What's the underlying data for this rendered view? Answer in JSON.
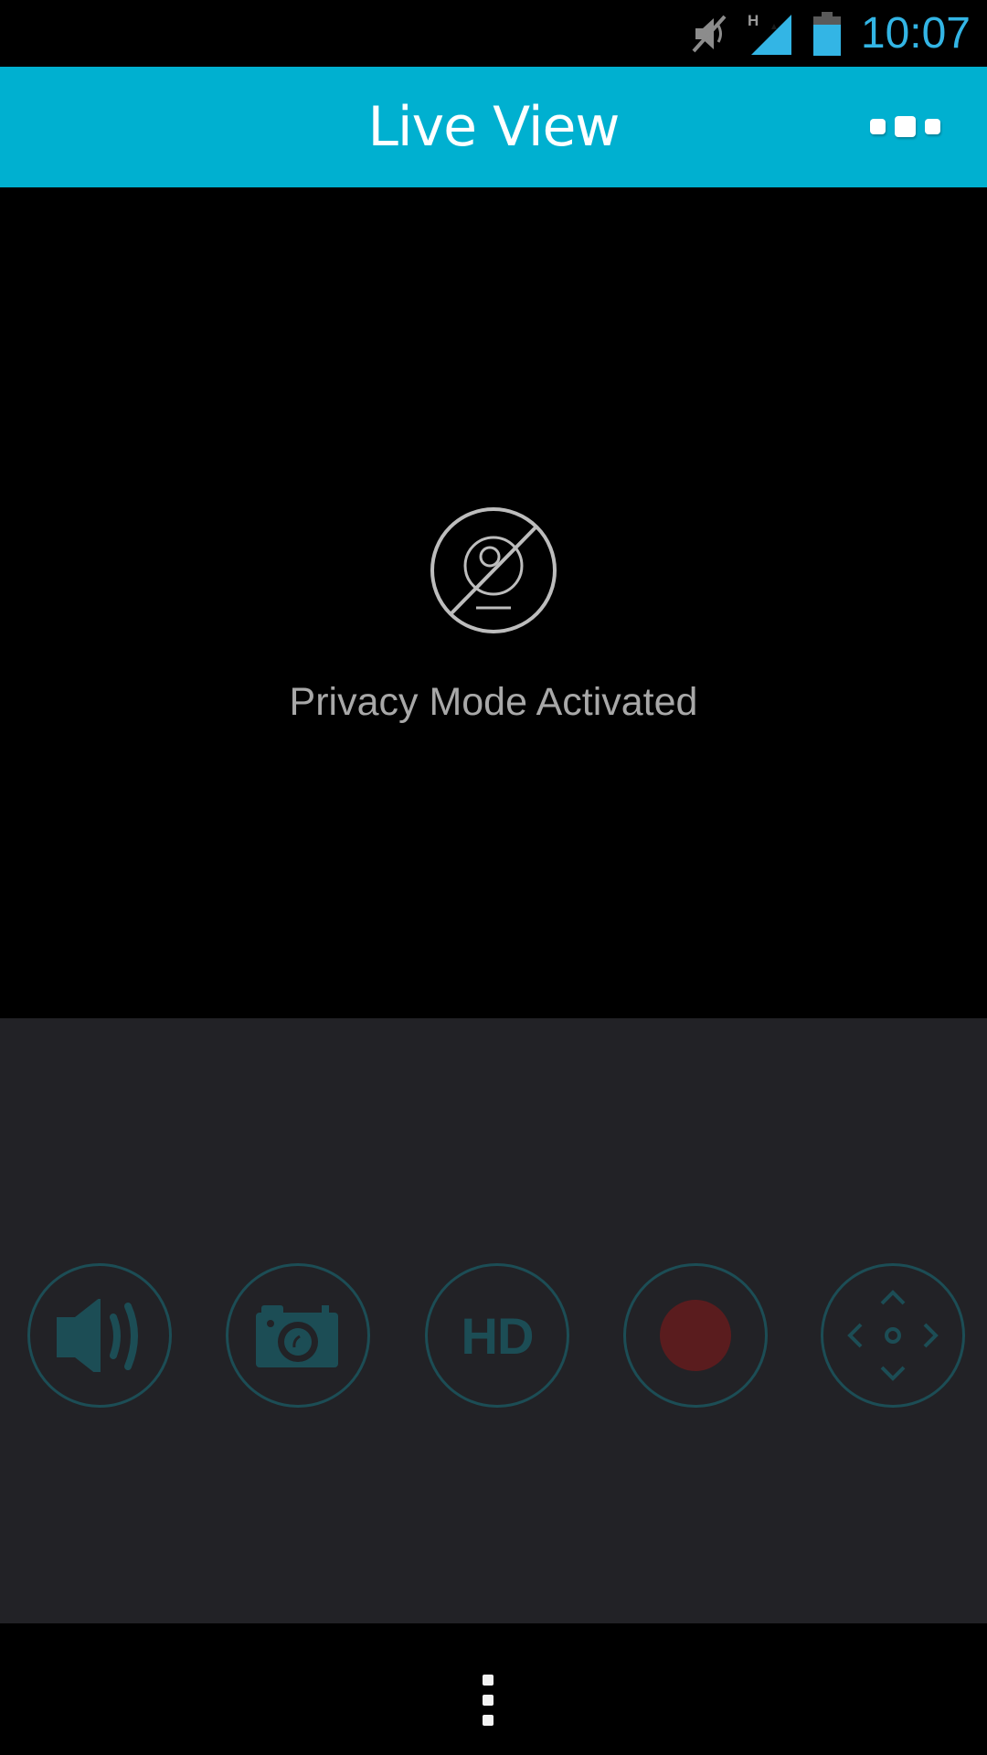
{
  "status_bar": {
    "icons": [
      "mute-icon",
      "hspa-signal-icon",
      "battery-icon"
    ],
    "network_type": "H",
    "time": "10:07",
    "accent_color": "#33b5e5"
  },
  "app_bar": {
    "title": "Live View",
    "menu_icon": "overflow-menu-icon",
    "background_color": "#00b0d0"
  },
  "video": {
    "status_icon": "camera-disabled-icon",
    "status_text": "Privacy Mode Activated"
  },
  "controls": [
    {
      "name": "audio",
      "icon": "speaker-icon"
    },
    {
      "name": "snapshot",
      "icon": "camera-icon"
    },
    {
      "name": "hd",
      "icon": "hd-icon",
      "label": "HD"
    },
    {
      "name": "record",
      "icon": "record-icon",
      "color": "#5a1c1e"
    },
    {
      "name": "pan-tilt",
      "icon": "directional-pad-icon"
    }
  ],
  "nav_bar": {
    "menu_icon": "overflow-menu-icon"
  }
}
